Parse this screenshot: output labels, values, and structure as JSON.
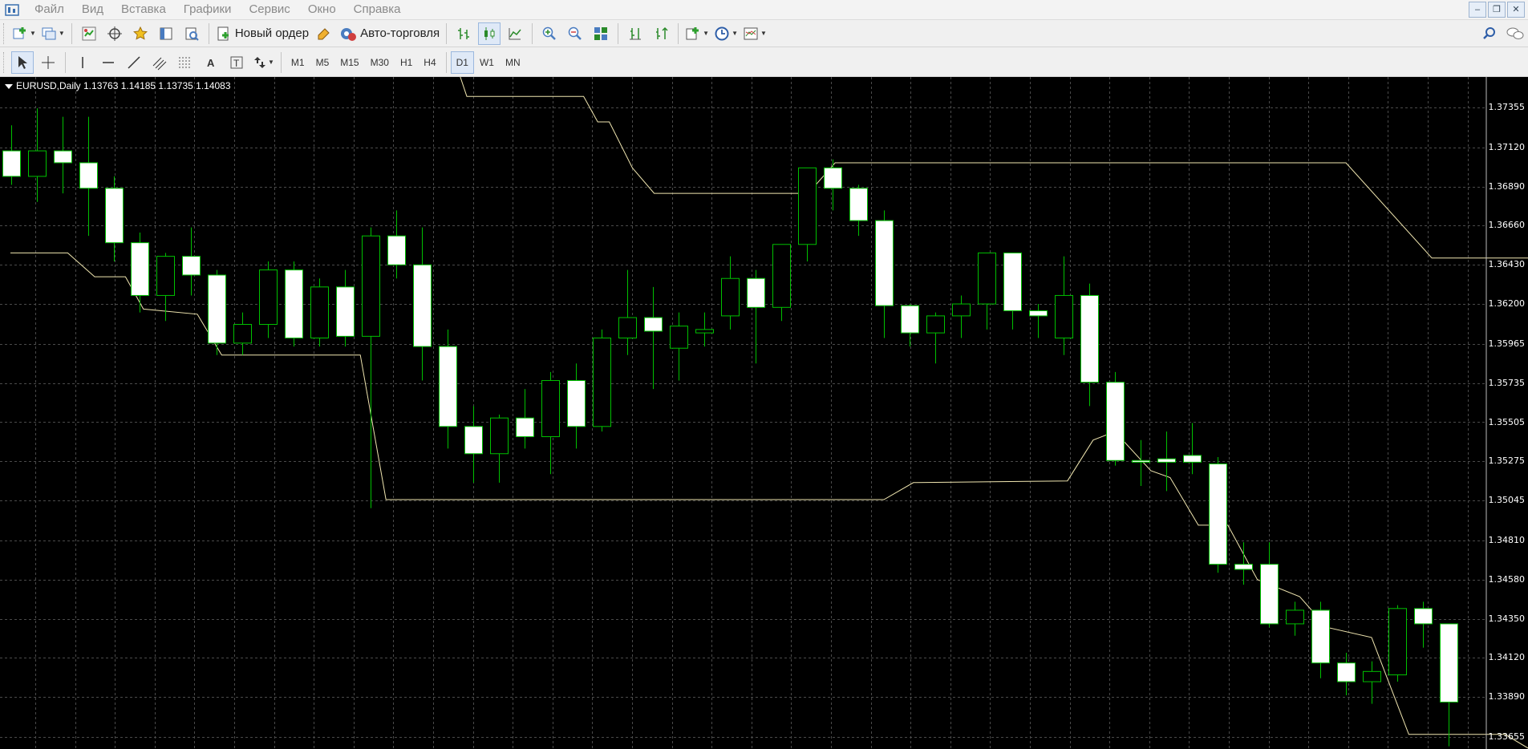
{
  "menubar": {
    "items": [
      "Файл",
      "Вид",
      "Вставка",
      "Графики",
      "Сервис",
      "Окно",
      "Справка"
    ]
  },
  "toolbar1": {
    "new_order_label": "Новый ордер",
    "auto_trading_label": "Авто-торговля",
    "icons": [
      "new-chart-icon",
      "profiles-icon",
      "market-watch-icon",
      "navigator-icon",
      "favorites-icon",
      "terminal-icon",
      "strategy-tester-icon",
      "new-order-icon",
      "metaeditor-icon",
      "auto-trading-icon",
      "bar-chart-icon",
      "candlestick-icon",
      "line-chart-icon",
      "zoom-in-icon",
      "zoom-out-icon",
      "tile-windows-icon",
      "chart-shift-icon",
      "autoscroll-icon",
      "indicators-icon",
      "periods-icon",
      "templates-icon",
      "search-icon",
      "chat-icon"
    ]
  },
  "toolbar2": {
    "timeframes": [
      "M1",
      "M5",
      "M15",
      "M30",
      "H1",
      "H4",
      "D1",
      "W1",
      "MN"
    ],
    "active_timeframe": "D1"
  },
  "chart": {
    "info": "EURUSD,Daily  1.13763 1.14185 1.13735 1.14083",
    "background": "#000000",
    "bull_color": "#00c000",
    "bear_fill": "#ffffff",
    "grid_color": "#4a4a4a",
    "band_color": "#f0e6b0"
  },
  "chart_data": {
    "type": "candlestick",
    "symbol": "EURUSD",
    "timeframe": "Daily",
    "ohlc_header": [
      1.13763,
      1.14185,
      1.13735,
      1.14083
    ],
    "ylim": [
      1.3359,
      1.376
    ],
    "y_ticks": [
      "1.37355",
      "1.37120",
      "1.36890",
      "1.36660",
      "1.36430",
      "1.36200",
      "1.35965",
      "1.35735",
      "1.35505",
      "1.35275",
      "1.35045",
      "1.34810",
      "1.34580",
      "1.34350",
      "1.34120",
      "1.33890",
      "1.33655"
    ],
    "grid": true,
    "candles": [
      [
        1.371,
        1.3725,
        1.369,
        1.3695,
        "bear"
      ],
      [
        1.3695,
        1.3735,
        1.368,
        1.371,
        "bull"
      ],
      [
        1.371,
        1.373,
        1.3685,
        1.3703,
        "bear"
      ],
      [
        1.3703,
        1.373,
        1.366,
        1.3688,
        "bear"
      ],
      [
        1.3688,
        1.3695,
        1.3645,
        1.3656,
        "bear"
      ],
      [
        1.3656,
        1.3662,
        1.3615,
        1.3625,
        "bear"
      ],
      [
        1.3625,
        1.365,
        1.361,
        1.3648,
        "bull"
      ],
      [
        1.3648,
        1.3665,
        1.3625,
        1.3637,
        "bear"
      ],
      [
        1.3637,
        1.364,
        1.359,
        1.3597,
        "bear"
      ],
      [
        1.3597,
        1.3615,
        1.359,
        1.3608,
        "bull"
      ],
      [
        1.3608,
        1.3645,
        1.36,
        1.364,
        "bull"
      ],
      [
        1.364,
        1.3645,
        1.3595,
        1.36,
        "bear"
      ],
      [
        1.36,
        1.3635,
        1.3595,
        1.363,
        "bull"
      ],
      [
        1.363,
        1.364,
        1.3595,
        1.3601,
        "bear"
      ],
      [
        1.3601,
        1.3665,
        1.35,
        1.366,
        "bull"
      ],
      [
        1.366,
        1.3675,
        1.3635,
        1.3643,
        "bear"
      ],
      [
        1.3643,
        1.3665,
        1.3575,
        1.3595,
        "bear"
      ],
      [
        1.3595,
        1.3605,
        1.3535,
        1.3548,
        "bear"
      ],
      [
        1.3548,
        1.356,
        1.3515,
        1.3532,
        "bear"
      ],
      [
        1.3532,
        1.3555,
        1.3515,
        1.3553,
        "bull"
      ],
      [
        1.3553,
        1.357,
        1.3535,
        1.3542,
        "bear"
      ],
      [
        1.3542,
        1.358,
        1.352,
        1.3575,
        "bull"
      ],
      [
        1.3575,
        1.3585,
        1.3535,
        1.3548,
        "bear"
      ],
      [
        1.3548,
        1.3605,
        1.3545,
        1.36,
        "bull"
      ],
      [
        1.36,
        1.364,
        1.359,
        1.3612,
        "bull"
      ],
      [
        1.3612,
        1.363,
        1.357,
        1.3604,
        "bear"
      ],
      [
        1.3594,
        1.3615,
        1.3575,
        1.3607,
        "bull"
      ],
      [
        1.3603,
        1.3615,
        1.3595,
        1.3605,
        "bull"
      ],
      [
        1.3613,
        1.3648,
        1.3605,
        1.3635,
        "bull"
      ],
      [
        1.3635,
        1.364,
        1.3585,
        1.3618,
        "bear"
      ],
      [
        1.3618,
        1.3655,
        1.361,
        1.3655,
        "bull"
      ],
      [
        1.3655,
        1.37,
        1.3645,
        1.37,
        "bull"
      ],
      [
        1.37,
        1.3705,
        1.3675,
        1.3688,
        "bear"
      ],
      [
        1.3688,
        1.369,
        1.366,
        1.3669,
        "bear"
      ],
      [
        1.3669,
        1.3675,
        1.36,
        1.3619,
        "bear"
      ],
      [
        1.3619,
        1.362,
        1.3595,
        1.3603,
        "bear"
      ],
      [
        1.3603,
        1.3615,
        1.3585,
        1.3613,
        "bull"
      ],
      [
        1.3613,
        1.3625,
        1.36,
        1.362,
        "bull"
      ],
      [
        1.362,
        1.3647,
        1.3605,
        1.365,
        "bull"
      ],
      [
        1.365,
        1.365,
        1.3605,
        1.3616,
        "bear"
      ],
      [
        1.3616,
        1.362,
        1.36,
        1.3613,
        "bear"
      ],
      [
        1.36,
        1.3648,
        1.359,
        1.3625,
        "bull"
      ],
      [
        1.3625,
        1.3632,
        1.356,
        1.3574,
        "bear"
      ],
      [
        1.3574,
        1.358,
        1.3525,
        1.3528,
        "bear"
      ],
      [
        1.3528,
        1.354,
        1.3513,
        1.3527,
        "bear"
      ],
      [
        1.3529,
        1.3545,
        1.351,
        1.3527,
        "bear"
      ],
      [
        1.3531,
        1.355,
        1.352,
        1.3527,
        "bear"
      ],
      [
        1.3526,
        1.353,
        1.3462,
        1.3467,
        "bear"
      ],
      [
        1.3467,
        1.348,
        1.3455,
        1.3464,
        "bear"
      ],
      [
        1.3467,
        1.348,
        1.343,
        1.3432,
        "bear"
      ],
      [
        1.3432,
        1.3445,
        1.3425,
        1.344,
        "bull"
      ],
      [
        1.344,
        1.3445,
        1.34,
        1.3409,
        "bear"
      ],
      [
        1.3409,
        1.3415,
        1.339,
        1.3398,
        "bear"
      ],
      [
        1.3398,
        1.341,
        1.3385,
        1.3404,
        "bull"
      ],
      [
        1.3402,
        1.3443,
        1.3398,
        1.3441,
        "bull"
      ],
      [
        1.3441,
        1.3445,
        1.3418,
        1.3432,
        "bear"
      ],
      [
        1.3432,
        1.3432,
        1.336,
        1.3386,
        "bear"
      ]
    ],
    "upper_band": [
      [
        -0.03,
        1.376
      ],
      [
        17.35,
        1.376
      ],
      [
        17.75,
        1.3742
      ],
      [
        22.3,
        1.3742
      ],
      [
        22.85,
        1.3727
      ],
      [
        23.3,
        1.3727
      ],
      [
        24.2,
        1.37
      ],
      [
        25.05,
        1.3685
      ],
      [
        31.05,
        1.3685
      ],
      [
        32.1,
        1.3703
      ],
      [
        52.0,
        1.3703
      ],
      [
        55.35,
        1.3647
      ],
      [
        59.2,
        1.3647
      ]
    ],
    "lower_band": [
      [
        -0.03,
        1.365
      ],
      [
        2.2,
        1.365
      ],
      [
        3.25,
        1.3636
      ],
      [
        4.45,
        1.3636
      ],
      [
        5.15,
        1.3617
      ],
      [
        7.25,
        1.3614
      ],
      [
        8.2,
        1.359
      ],
      [
        13.6,
        1.359
      ],
      [
        14.6,
        1.3505
      ],
      [
        34.0,
        1.3505
      ],
      [
        35.15,
        1.3515
      ],
      [
        41.15,
        1.3516
      ],
      [
        42.15,
        1.354
      ],
      [
        43.0,
        1.3545
      ],
      [
        44.4,
        1.3522
      ],
      [
        45.15,
        1.3518
      ],
      [
        46.25,
        1.349
      ],
      [
        47.4,
        1.349
      ],
      [
        48.55,
        1.3458
      ],
      [
        50.2,
        1.3448
      ],
      [
        51.25,
        1.343
      ],
      [
        53.0,
        1.3424
      ],
      [
        54.45,
        1.3367
      ],
      [
        58.2,
        1.3367
      ],
      [
        59.2,
        1.3358
      ]
    ]
  }
}
